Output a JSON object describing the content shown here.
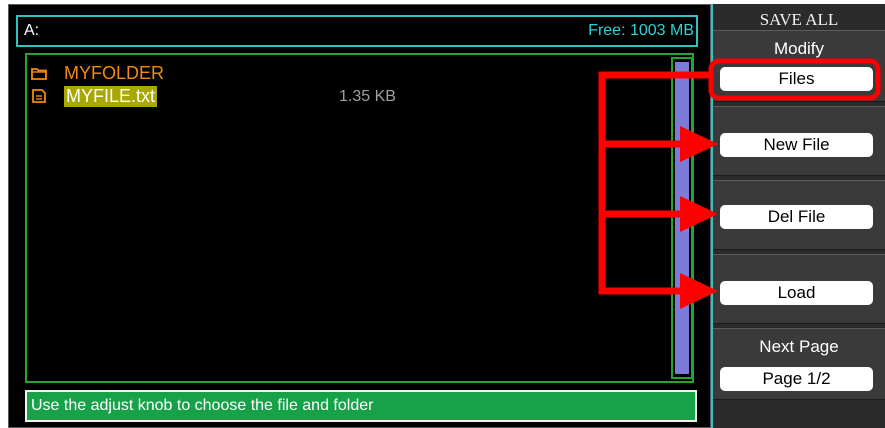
{
  "header": {
    "path": "A:",
    "free_space": "Free: 1003 MB"
  },
  "files": [
    {
      "name": "MYFOLDER",
      "type": "folder",
      "icon": "folder-icon",
      "selected": false
    },
    {
      "name": "MYFILE.txt",
      "type": "file",
      "icon": "text-file-icon",
      "selected": true,
      "size": "1.35 KB"
    }
  ],
  "status": {
    "message": "Use the adjust knob to choose the file and folder"
  },
  "menu": {
    "title": "SAVE ALL",
    "modify_label": "Modify",
    "files_button": "Files",
    "new_file_button": "New File",
    "del_file_button": "Del File",
    "load_button": "Load",
    "next_page_label": "Next Page",
    "page_button": "Page 1/2"
  },
  "colors": {
    "accent_cyan": "#2fc3c3",
    "folder_orange": "#f08a10",
    "selection_olive": "#a8a800",
    "panel_green": "#21a52b",
    "status_green": "#17a24a",
    "scroll_thumb": "#7b7bd8",
    "annotation_red": "#ff0000"
  }
}
